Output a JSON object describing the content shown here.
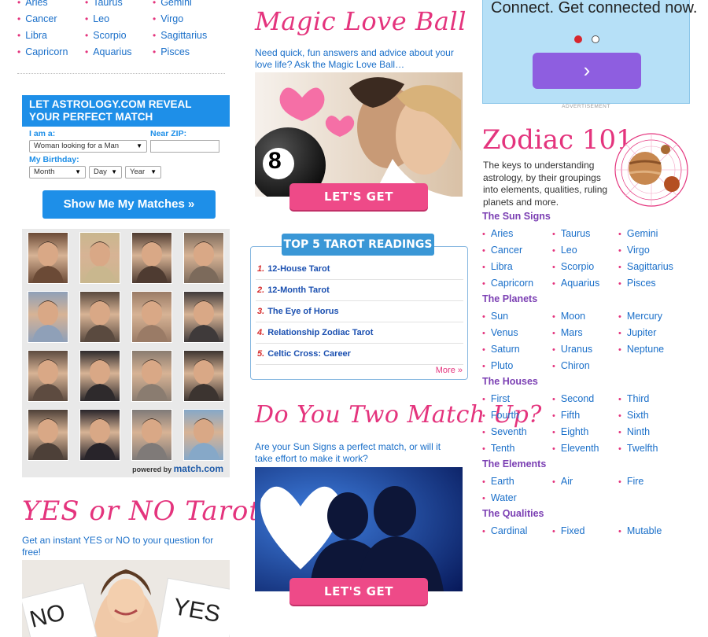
{
  "top_signs": {
    "items": [
      "Aries",
      "Taurus",
      "Gemini",
      "Cancer",
      "Leo",
      "Virgo",
      "Libra",
      "Scorpio",
      "Sagittarius",
      "Capricorn",
      "Aquarius",
      "Pisces"
    ]
  },
  "match": {
    "header": "LET ASTROLOGY.COM REVEAL YOUR PERFECT MATCH",
    "i_am_label": "I am a:",
    "i_am_value": "Woman looking for a Man",
    "zip_label": "Near ZIP:",
    "birthday_label": "My Birthday:",
    "month": "Month",
    "day": "Day",
    "year": "Year",
    "button": "Show Me My Matches »",
    "powered_by": "powered by",
    "brand": "match.com"
  },
  "yesno": {
    "title": "YES or NO Tarot",
    "desc": "Get an instant YES or NO to your question for free!",
    "sign_no": "NO",
    "sign_yes": "YES"
  },
  "love_ball": {
    "title": "Magic Love Ball",
    "desc": "Need quick, fun answers and advice about your love life? Ask the Magic Love Ball…",
    "ball_number": "8",
    "cta": "LET'S GET STARTED!"
  },
  "tarot": {
    "banner": "TOP 5 TAROT READINGS",
    "items": [
      {
        "num": "1.",
        "label": "12-House Tarot"
      },
      {
        "num": "2.",
        "label": "12-Month Tarot"
      },
      {
        "num": "3.",
        "label": "The Eye of Horus"
      },
      {
        "num": "4.",
        "label": "Relationship Zodiac Tarot"
      },
      {
        "num": "5.",
        "label": "Celtic Cross: Career"
      }
    ],
    "more": "More »"
  },
  "match_up": {
    "title": "Do You Two Match Up?",
    "desc": "Are your Sun Signs a perfect match, or will it take effort to make it work?",
    "cta": "LET'S GET STARTED!"
  },
  "carousel": {
    "headline": "Connect. Get connected now.",
    "next_glyph": "›",
    "ad_label": "ADVERTISEMENT"
  },
  "zodiac": {
    "title": "Zodiac 101",
    "desc": "The keys to understanding astrology, by their groupings into elements, qualities, ruling planets and more.",
    "sections": [
      {
        "title": "The Sun Signs",
        "items": [
          "Aries",
          "Taurus",
          "Gemini",
          "Cancer",
          "Leo",
          "Virgo",
          "Libra",
          "Scorpio",
          "Sagittarius",
          "Capricorn",
          "Aquarius",
          "Pisces"
        ]
      },
      {
        "title": "The Planets",
        "items": [
          "Sun",
          "Moon",
          "Mercury",
          "Venus",
          "Mars",
          "Jupiter",
          "Saturn",
          "Uranus",
          "Neptune",
          "Pluto",
          "Chiron"
        ]
      },
      {
        "title": "The Houses",
        "items": [
          "First",
          "Second",
          "Third",
          "Fourth",
          "Fifth",
          "Sixth",
          "Seventh",
          "Eighth",
          "Ninth",
          "Tenth",
          "Eleventh",
          "Twelfth"
        ]
      },
      {
        "title": "The Elements",
        "items": [
          "Earth",
          "Air",
          "Fire",
          "Water"
        ]
      },
      {
        "title": "The Qualities",
        "items": [
          "Cardinal",
          "Fixed",
          "Mutable"
        ]
      }
    ]
  },
  "colors": {
    "accent_pink": "#e4347d",
    "link_blue": "#1a6fc9",
    "section_purple": "#7b3fb3",
    "match_blue": "#1e8fe8"
  }
}
